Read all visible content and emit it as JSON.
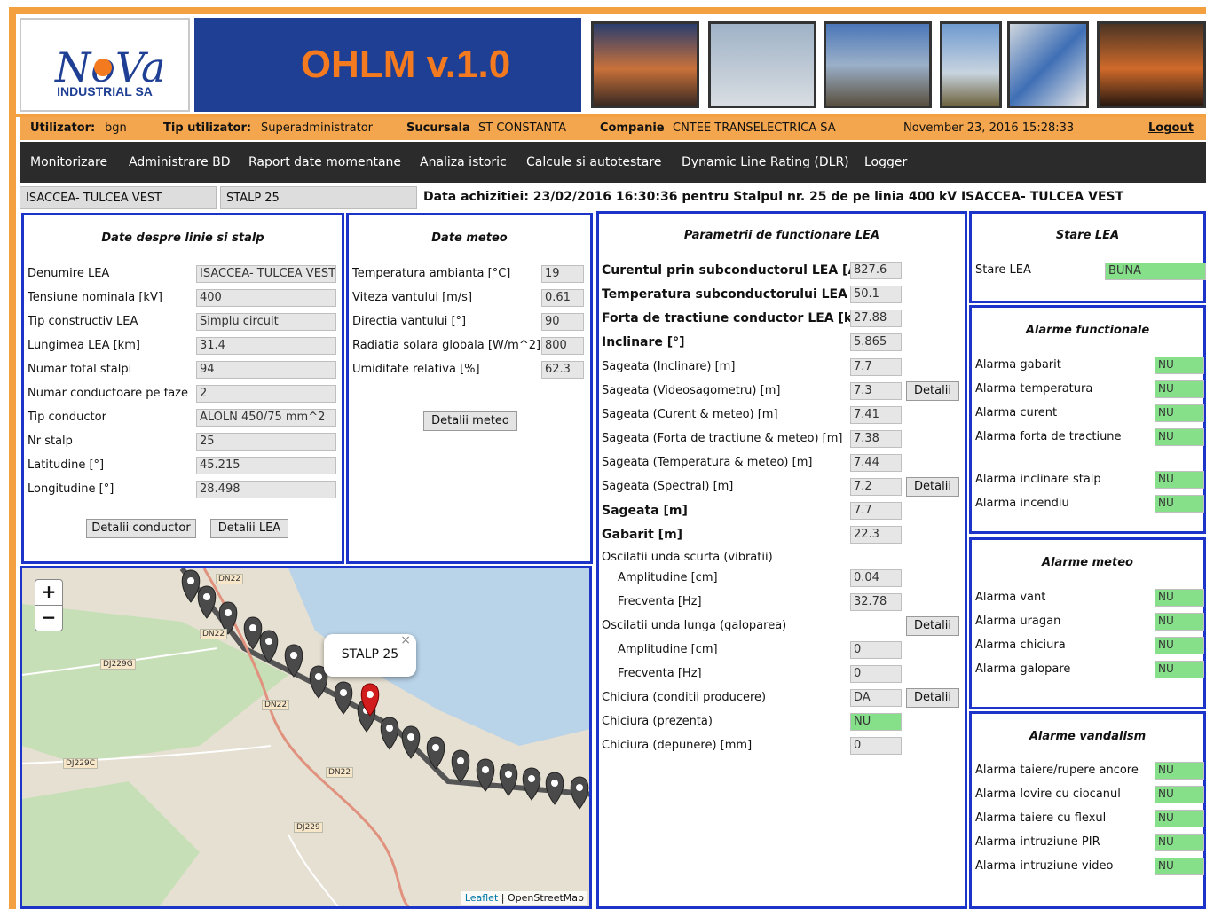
{
  "header": {
    "brand_name": "NoVa",
    "brand_sub": "INDUSTRIAL SA",
    "app_title": "OHLM v.1.0",
    "photos": [
      "power-lines-sunset",
      "transmission-tower-sky",
      "towers-field",
      "line-landscape",
      "sensor-equipment",
      "tower-silhouette"
    ]
  },
  "userbar": {
    "user_label": "Utilizator:",
    "user_value": "bgn",
    "type_label": "Tip utilizator:",
    "type_value": "Superadministrator",
    "branch_label": "Sucursala",
    "branch_value": "ST CONSTANTA",
    "company_label": "Companie",
    "company_value": "CNTEE TRANSELECTRICA SA",
    "datetime": "November 23, 2016 15:28:33",
    "logout": "Logout"
  },
  "nav": [
    "Monitorizare",
    "Administrare BD",
    "Raport date momentane",
    "Analiza istoric",
    "Calcule si autotestare",
    "Dynamic Line Rating (DLR)",
    "Logger"
  ],
  "info": {
    "line": "ISACCEA- TULCEA VEST",
    "pole": "STALP 25",
    "acquisition": "Data achizitiei: 23/02/2016 16:30:36 pentru Stalpul nr. 25 de pe linia 400 kV ISACCEA- TULCEA VEST"
  },
  "line_panel": {
    "title": "Date despre linie si stalp",
    "rows": [
      {
        "label": "Denumire LEA",
        "value": "ISACCEA- TULCEA VEST"
      },
      {
        "label": "Tensiune nominala [kV]",
        "value": "400"
      },
      {
        "label": "Tip constructiv LEA",
        "value": "Simplu circuit"
      },
      {
        "label": "Lungimea LEA [km]",
        "value": "31.4"
      },
      {
        "label": "Numar total stalpi",
        "value": "94"
      },
      {
        "label": "Numar conductoare pe faze",
        "value": "2"
      },
      {
        "label": "Tip conductor",
        "value": "ALOLN 450/75 mm^2"
      },
      {
        "label": "Nr stalp",
        "value": "25"
      },
      {
        "label": "Latitudine [°]",
        "value": "45.215"
      },
      {
        "label": "Longitudine [°]",
        "value": "28.498"
      }
    ],
    "btn_conductor": "Detalii conductor",
    "btn_lea": "Detalii LEA"
  },
  "meteo_panel": {
    "title": "Date meteo",
    "rows": [
      {
        "label": "Temperatura ambianta [°C]",
        "value": "19"
      },
      {
        "label": "Viteza vantului [m/s]",
        "value": "0.61"
      },
      {
        "label": "Directia vantului [°]",
        "value": "90"
      },
      {
        "label": "Radiatia solara globala [W/m^2]",
        "value": "800"
      },
      {
        "label": "Umiditate relativa [%]",
        "value": "62.3"
      }
    ],
    "btn": "Detalii meteo"
  },
  "params_panel": {
    "title": "Parametrii de functionare LEA",
    "detail_label": "Detalii",
    "rows": [
      {
        "label": "Curentul prin subconductorul LEA [A]",
        "value": "827.6",
        "bold": true
      },
      {
        "label": "Temperatura subconductorului LEA [°C]",
        "value": "50.1",
        "bold": true
      },
      {
        "label": "Forta de tractiune conductor LEA [kN]",
        "value": "27.88",
        "bold": true
      },
      {
        "label": "Inclinare [°]",
        "value": "5.865",
        "bold": true
      },
      {
        "label": "Sageata (Inclinare) [m]",
        "value": "7.7"
      },
      {
        "label": "Sageata (Videosagometru) [m]",
        "value": "7.3",
        "detail": true
      },
      {
        "label": "Sageata (Curent & meteo) [m]",
        "value": "7.41"
      },
      {
        "label": "Sageata (Forta de tractiune & meteo) [m]",
        "value": "7.38"
      },
      {
        "label": "Sageata (Temperatura & meteo) [m]",
        "value": "7.44"
      },
      {
        "label": "Sageata (Spectral) [m]",
        "value": "7.2",
        "detail": true
      },
      {
        "label": "Sageata [m]",
        "value": "7.7",
        "bold": true
      },
      {
        "label": "Gabarit [m]",
        "value": "22.3",
        "bold": true
      },
      {
        "label": "Oscilatii unda scurta (vibratii)",
        "value": null
      },
      {
        "label": "Amplitudine [cm]",
        "value": "0.04",
        "indent": true
      },
      {
        "label": "Frecventa [Hz]",
        "value": "32.78",
        "indent": true
      },
      {
        "label": "Oscilatii unda lunga (galoparea)",
        "value": null,
        "detail": true
      },
      {
        "label": "Amplitudine [cm]",
        "value": "0",
        "indent": true
      },
      {
        "label": "Frecventa [Hz]",
        "value": "0",
        "indent": true
      },
      {
        "label": "Chiciura (conditii producere)",
        "value": "DA",
        "detail": true
      },
      {
        "label": "Chiciura (prezenta)",
        "value": "NU",
        "green": true
      },
      {
        "label": "Chiciura (depunere) [mm]",
        "value": "0"
      }
    ]
  },
  "stare": {
    "title": "Stare LEA",
    "label": "Stare LEA",
    "value": "BUNA"
  },
  "alarme_functionale": {
    "title": "Alarme functionale",
    "rows": [
      {
        "label": "Alarma gabarit",
        "value": "NU"
      },
      {
        "label": "Alarma temperatura",
        "value": "NU"
      },
      {
        "label": "Alarma curent",
        "value": "NU"
      },
      {
        "label": "Alarma forta de tractiune",
        "value": "NU"
      },
      {
        "label": "Alarma inclinare stalp",
        "value": "NU"
      },
      {
        "label": "Alarma incendiu",
        "value": "NU"
      }
    ]
  },
  "alarme_meteo": {
    "title": "Alarme meteo",
    "rows": [
      {
        "label": "Alarma vant",
        "value": "NU"
      },
      {
        "label": "Alarma uragan",
        "value": "NU"
      },
      {
        "label": "Alarma chiciura",
        "value": "NU"
      },
      {
        "label": "Alarma galopare",
        "value": "NU"
      }
    ]
  },
  "alarme_vandalism": {
    "title": "Alarme vandalism",
    "rows": [
      {
        "label": "Alarma taiere/rupere ancore",
        "value": "NU"
      },
      {
        "label": "Alarma lovire cu ciocanul",
        "value": "NU"
      },
      {
        "label": "Alarma taiere cu flexul",
        "value": "NU"
      },
      {
        "label": "Alarma intruziune PIR",
        "value": "NU"
      },
      {
        "label": "Alarma intruziune video",
        "value": "NU"
      }
    ]
  },
  "map": {
    "zoom_in": "+",
    "zoom_out": "−",
    "popup": "STALP 25",
    "popup_close": "×",
    "roads": [
      "DN22",
      "DN22",
      "DJ229G",
      "DN22",
      "DJ229C",
      "DN22",
      "DJ229"
    ],
    "attribution_leaflet": "Leaflet",
    "attribution_sep": " | ",
    "attribution_osm": "OpenStreetMap"
  },
  "colors": {
    "orange": "#f2a040",
    "banner": "#1f3f94",
    "title": "#f47a20",
    "panel_border": "#1c35c8",
    "ok_green": "#86e08a"
  }
}
